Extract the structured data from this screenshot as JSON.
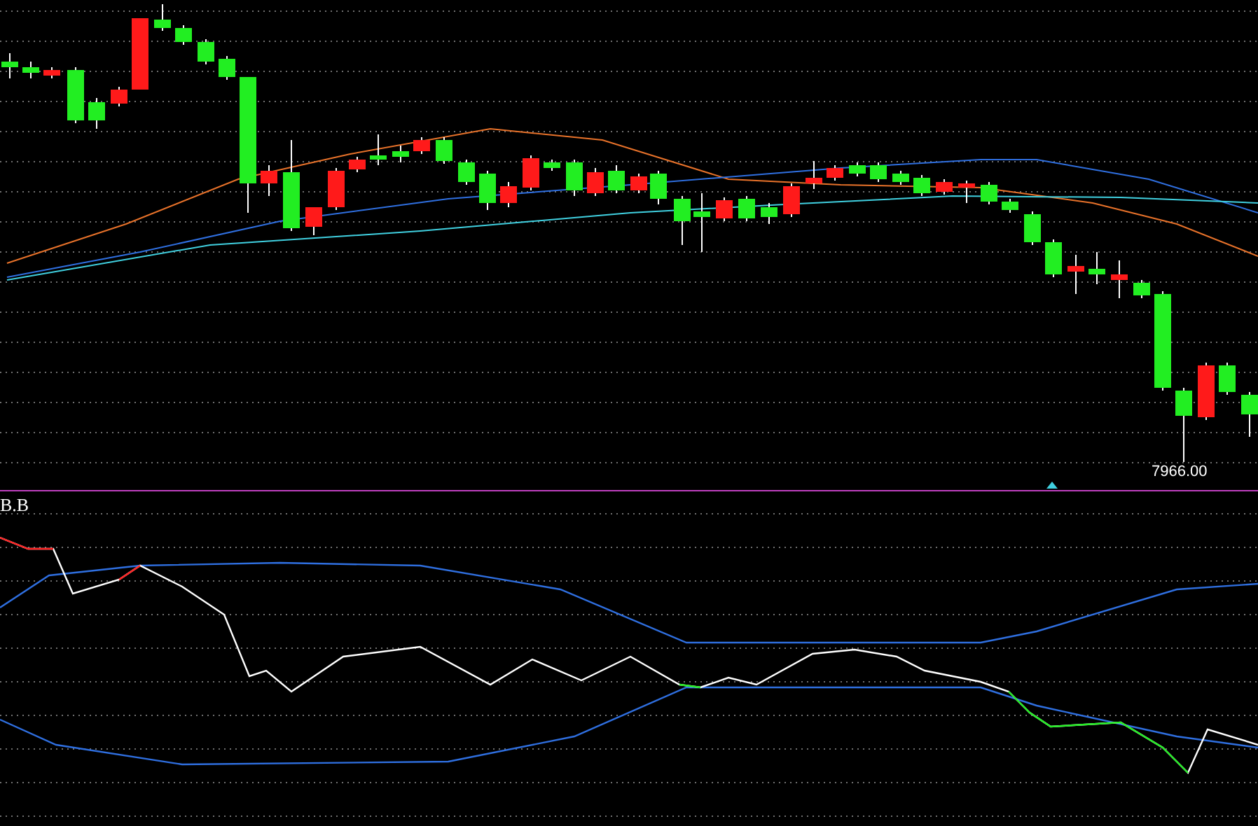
{
  "price_chart": {
    "low_label": "7966.00"
  },
  "indicator_panel": {
    "label": "B.B"
  }
}
